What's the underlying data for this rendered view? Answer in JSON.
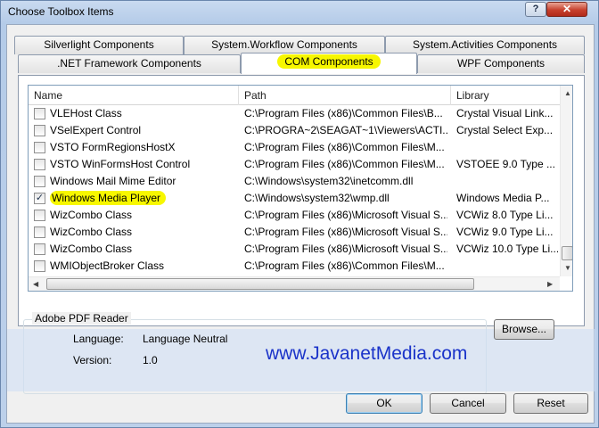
{
  "window": {
    "title": "Choose Toolbox Items",
    "help_label": "?",
    "close_label": "✕"
  },
  "tabs": {
    "row1": [
      {
        "label": "Silverlight Components"
      },
      {
        "label": "System.Workflow Components"
      },
      {
        "label": "System.Activities Components"
      }
    ],
    "row2": [
      {
        "label": ".NET Framework Components"
      },
      {
        "label": "COM Components",
        "active": true
      },
      {
        "label": "WPF Components"
      }
    ]
  },
  "list": {
    "columns": [
      "Name",
      "Path",
      "Library"
    ],
    "rows": [
      {
        "checked": false,
        "name": "VLEHost Class",
        "path": "C:\\Program Files (x86)\\Common Files\\B...",
        "library": "Crystal Visual Link..."
      },
      {
        "checked": false,
        "name": "VSelExpert Control",
        "path": "C:\\PROGRA~2\\SEAGAT~1\\Viewers\\ACTI...",
        "library": "Crystal Select Exp..."
      },
      {
        "checked": false,
        "name": "VSTO FormRegionsHostX",
        "path": "C:\\Program Files (x86)\\Common Files\\M...",
        "library": ""
      },
      {
        "checked": false,
        "name": "VSTO WinFormsHost Control",
        "path": "C:\\Program Files (x86)\\Common Files\\M...",
        "library": "VSTOEE 9.0 Type ..."
      },
      {
        "checked": false,
        "name": "Windows Mail Mime Editor",
        "path": "C:\\Windows\\system32\\inetcomm.dll",
        "library": ""
      },
      {
        "checked": true,
        "name": "Windows Media Player",
        "path": "C:\\Windows\\system32\\wmp.dll",
        "library": "Windows Media P...",
        "highlight": true
      },
      {
        "checked": false,
        "name": "WizCombo Class",
        "path": "C:\\Program Files (x86)\\Microsoft Visual S...",
        "library": "VCWiz 8.0 Type Li..."
      },
      {
        "checked": false,
        "name": "WizCombo Class",
        "path": "C:\\Program Files (x86)\\Microsoft Visual S...",
        "library": "VCWiz 9.0 Type Li..."
      },
      {
        "checked": false,
        "name": "WizCombo Class",
        "path": "C:\\Program Files (x86)\\Microsoft Visual S...",
        "library": "VCWiz 10.0 Type Li..."
      },
      {
        "checked": false,
        "name": "WMIObjectBroker Class",
        "path": "C:\\Program Files (x86)\\Common Files\\M...",
        "library": ""
      }
    ]
  },
  "details": {
    "group_title": "Adobe PDF Reader",
    "language_label": "Language:",
    "language_value": "Language Neutral",
    "version_label": "Version:",
    "version_value": "1.0"
  },
  "watermark": "www.JavanetMedia.com",
  "buttons": {
    "browse": "Browse...",
    "ok": "OK",
    "cancel": "Cancel",
    "reset": "Reset"
  },
  "colors": {
    "highlight": "#f7f700",
    "watermark": "#1a33c9",
    "accent": "#3c7fb1"
  }
}
